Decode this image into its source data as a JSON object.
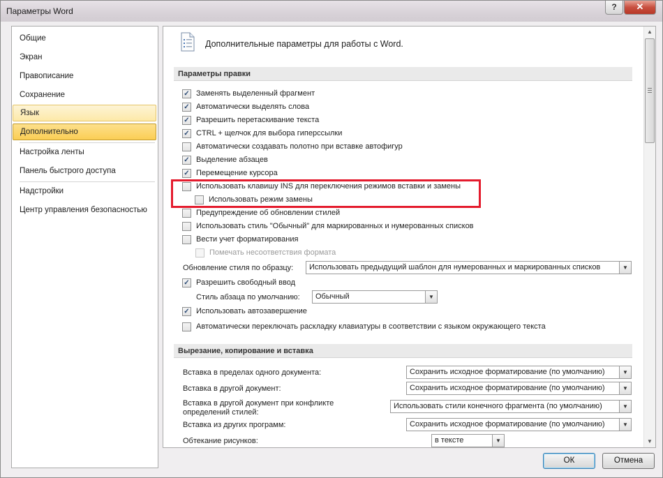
{
  "window": {
    "title": "Параметры Word",
    "help_glyph": "?",
    "close_glyph": "✕"
  },
  "sidebar": {
    "items": [
      {
        "label": "Общие"
      },
      {
        "label": "Экран"
      },
      {
        "label": "Правописание"
      },
      {
        "label": "Сохранение"
      },
      {
        "label": "Язык"
      },
      {
        "label": "Дополнительно"
      },
      {
        "label": "Настройка ленты"
      },
      {
        "label": "Панель быстрого доступа"
      },
      {
        "label": "Надстройки"
      },
      {
        "label": "Центр управления безопасностью"
      }
    ],
    "selected": "Дополнительно"
  },
  "page": {
    "title": "Дополнительные параметры для работы с Word.",
    "icon": "document-settings-icon"
  },
  "sections": {
    "editing": {
      "title": "Параметры правки",
      "options": [
        {
          "label": "Заменять выделенный фрагмент",
          "checked": true
        },
        {
          "label": "Автоматически выделять слова",
          "checked": true
        },
        {
          "label": "Разрешить перетаскивание текста",
          "checked": true
        },
        {
          "label": "CTRL + щелчок для выбора гиперссылки",
          "checked": true
        },
        {
          "label": "Автоматически создавать полотно при вставке автофигур",
          "checked": false
        },
        {
          "label": "Выделение абзацев",
          "checked": true
        },
        {
          "label": "Перемещение курсора",
          "checked": true
        },
        {
          "label": "Использовать клавишу INS для переключения режимов вставки и замены",
          "checked": false
        },
        {
          "label": "Использовать режим замены",
          "checked": false
        },
        {
          "label": "Предупреждение об обновлении стилей",
          "checked": false
        },
        {
          "label": "Использовать стиль \"Обычный\" для маркированных и нумерованных списков",
          "checked": false
        },
        {
          "label": "Вести учет форматирования",
          "checked": false
        },
        {
          "label": "Помечать несоответствия формата",
          "checked": false,
          "disabled": true
        }
      ],
      "style_update": {
        "label": "Обновление стиля по образцу:",
        "value": "Использовать предыдущий шаблон для нумерованных и маркированных списков"
      },
      "free_input": {
        "label": "Разрешить свободный ввод",
        "checked": true
      },
      "default_paragraph_style": {
        "label": "Стиль абзаца по умолчанию:",
        "value": "Обычный"
      },
      "autocomplete": {
        "label": "Использовать автозавершение",
        "checked": true
      },
      "auto_keyboard": {
        "label": "Автоматически переключать раскладку клавиатуры в соответствии с языком окружающего текста",
        "checked": false
      }
    },
    "cut_copy_paste": {
      "title": "Вырезание, копирование и вставка",
      "rows": [
        {
          "label": "Вставка в пределах одного документа:",
          "value": "Сохранить исходное форматирование (по умолчанию)"
        },
        {
          "label": "Вставка в другой документ:",
          "value": "Сохранить исходное форматирование (по умолчанию)"
        },
        {
          "label_line1": "Вставка в другой документ при конфликте",
          "label_line2": "определений стилей:",
          "value": "Использовать стили конечного фрагмента (по умолчанию)"
        },
        {
          "label": "Вставка из других программ:",
          "value": "Сохранить исходное форматирование (по умолчанию)"
        },
        {
          "label": "Обтекание рисунков:",
          "value": "в тексте"
        }
      ]
    }
  },
  "buttons": {
    "ok": "ОК",
    "cancel": "Отмена"
  },
  "colors": {
    "highlight_border": "#e41b2d",
    "selected_nav": "#fbce54"
  }
}
